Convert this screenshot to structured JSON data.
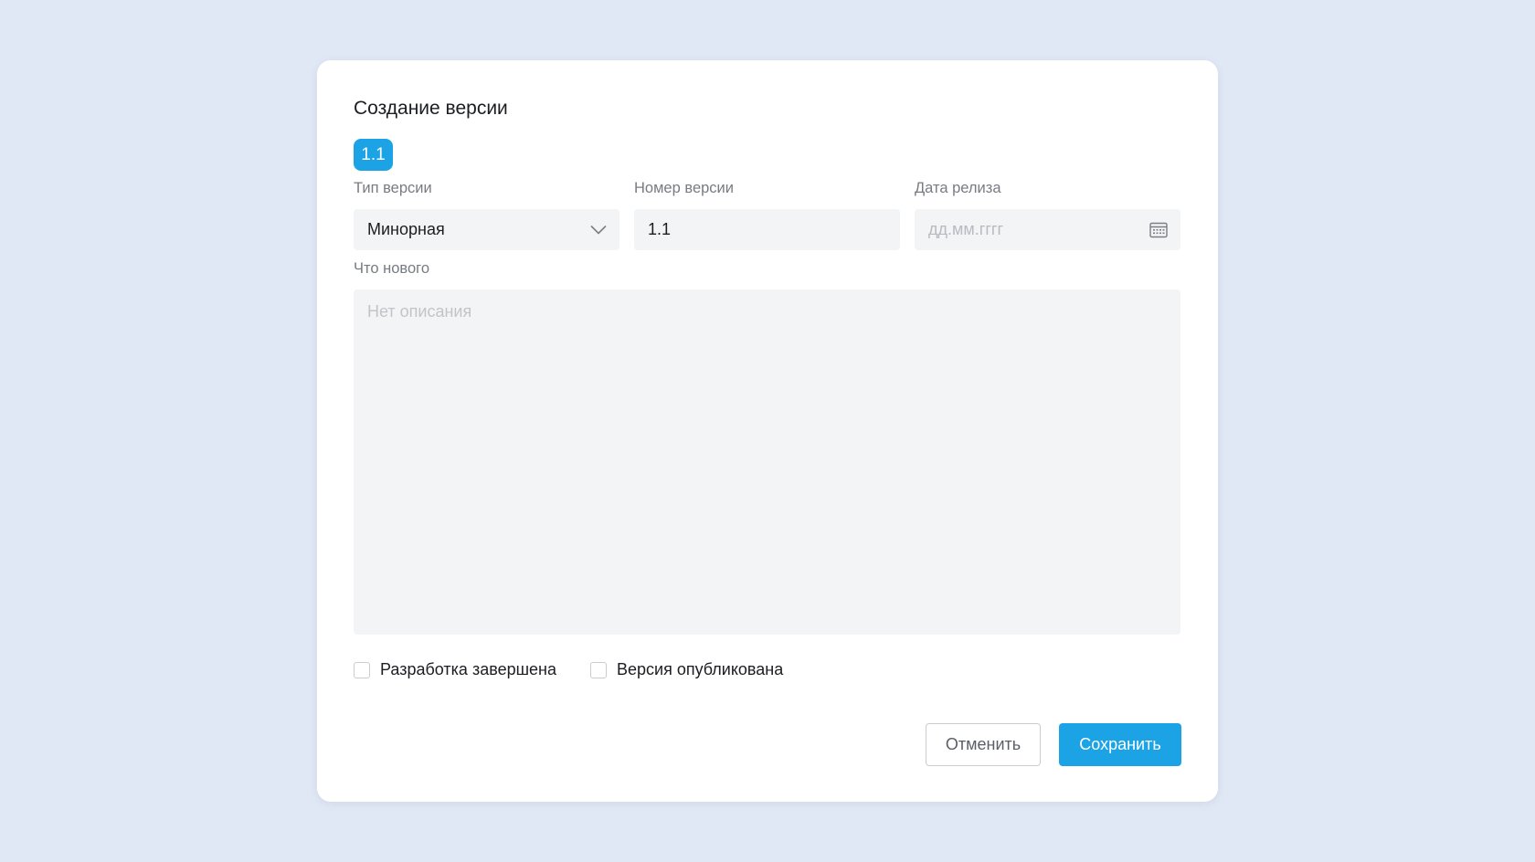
{
  "dialog": {
    "title": "Создание версии",
    "badge": "1.1"
  },
  "form": {
    "version_type": {
      "label": "Тип версии",
      "value": "Минорная"
    },
    "version_number": {
      "label": "Номер версии",
      "value": "1.1"
    },
    "release_date": {
      "label": "Дата релиза",
      "placeholder": "дд.мм.гггг"
    },
    "whats_new": {
      "label": "Что нового",
      "placeholder": "Нет описания"
    },
    "checkboxes": [
      {
        "label": "Разработка завершена",
        "checked": false
      },
      {
        "label": "Версия опубликована",
        "checked": false
      }
    ]
  },
  "actions": {
    "cancel_label": "Отменить",
    "save_label": "Сохранить"
  },
  "colors": {
    "accent": "#1ca3e5",
    "background": "#e1e8f5",
    "field_bg": "#f3f4f6"
  },
  "icons": {
    "select": "chevron-down-icon",
    "date": "calendar-icon"
  }
}
